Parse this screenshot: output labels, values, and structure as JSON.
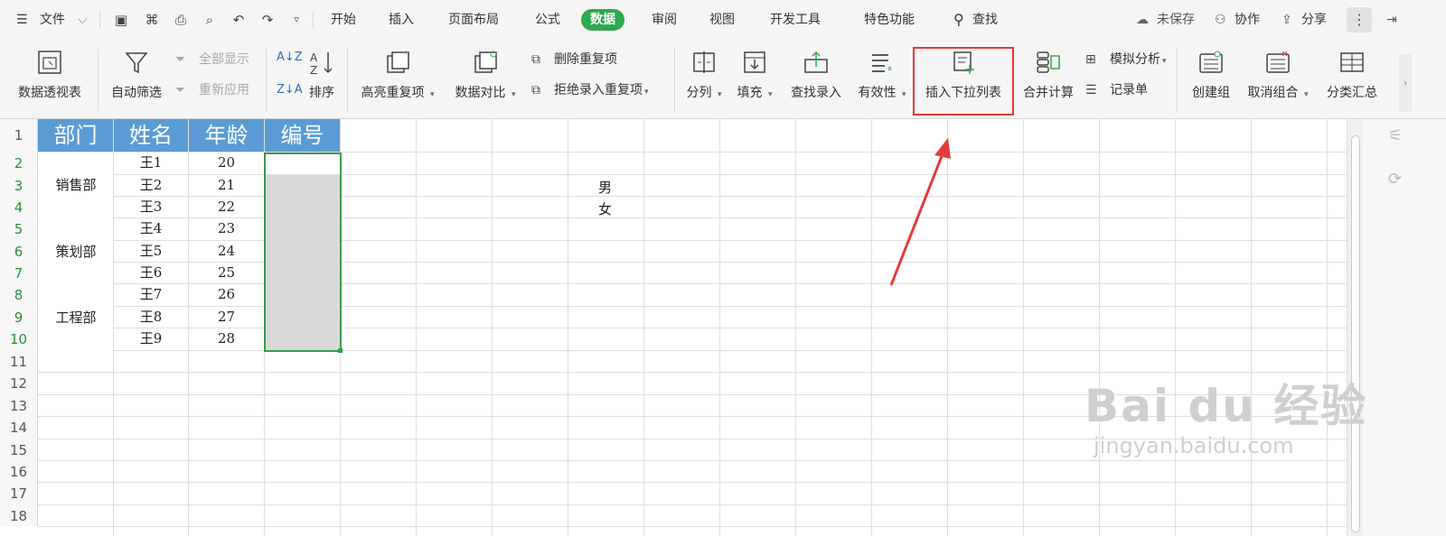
{
  "menubar": {
    "file_label": "文件",
    "tabs": [
      "开始",
      "插入",
      "页面布局",
      "公式",
      "数据",
      "审阅",
      "视图",
      "开发工具",
      "特色功能"
    ],
    "active_tab": "数据",
    "search_label": "查找",
    "unsaved_label": "未保存",
    "collab_label": "协作",
    "share_label": "分享"
  },
  "ribbon": {
    "pivot": "数据透视表",
    "autofilter": "自动筛选",
    "show_all": "全部显示",
    "reapply": "重新应用",
    "sort": "排序",
    "highlight_dup": "高亮重复项",
    "compare": "数据对比",
    "remove_dup": "删除重复项",
    "reject_dup": "拒绝录入重复项",
    "split": "分列",
    "fill": "填充",
    "lookup": "查找录入",
    "validity": "有效性",
    "insert_dropdown": "插入下拉列表",
    "consolidate": "合并计算",
    "whatif": "模拟分析",
    "record_form": "记录单",
    "group": "创建组",
    "ungroup": "取消组合",
    "subtotal": "分类汇总"
  },
  "sheet": {
    "row_numbers": [
      "1",
      "2",
      "3",
      "4",
      "5",
      "6",
      "7",
      "8",
      "9",
      "10",
      "11",
      "12",
      "13",
      "14",
      "15",
      "16",
      "17",
      "18"
    ],
    "headers": [
      "部门",
      "姓名",
      "年龄",
      "编号"
    ],
    "departments": [
      "销售部",
      "策划部",
      "工程部"
    ],
    "names": [
      "王1",
      "王2",
      "王3",
      "王4",
      "王5",
      "王6",
      "王7",
      "王8",
      "王9"
    ],
    "ages": [
      "20",
      "21",
      "22",
      "23",
      "24",
      "25",
      "26",
      "27",
      "28"
    ],
    "side_values": [
      "男",
      "女"
    ]
  },
  "watermark": {
    "brand": "Bai du 经验",
    "url": "jingyan.baidu.com"
  },
  "colors": {
    "header_fill": "#5b9bd5",
    "active_tab": "#2fa84f",
    "selection": "#3b9a4d",
    "annotation": "#e53935"
  }
}
